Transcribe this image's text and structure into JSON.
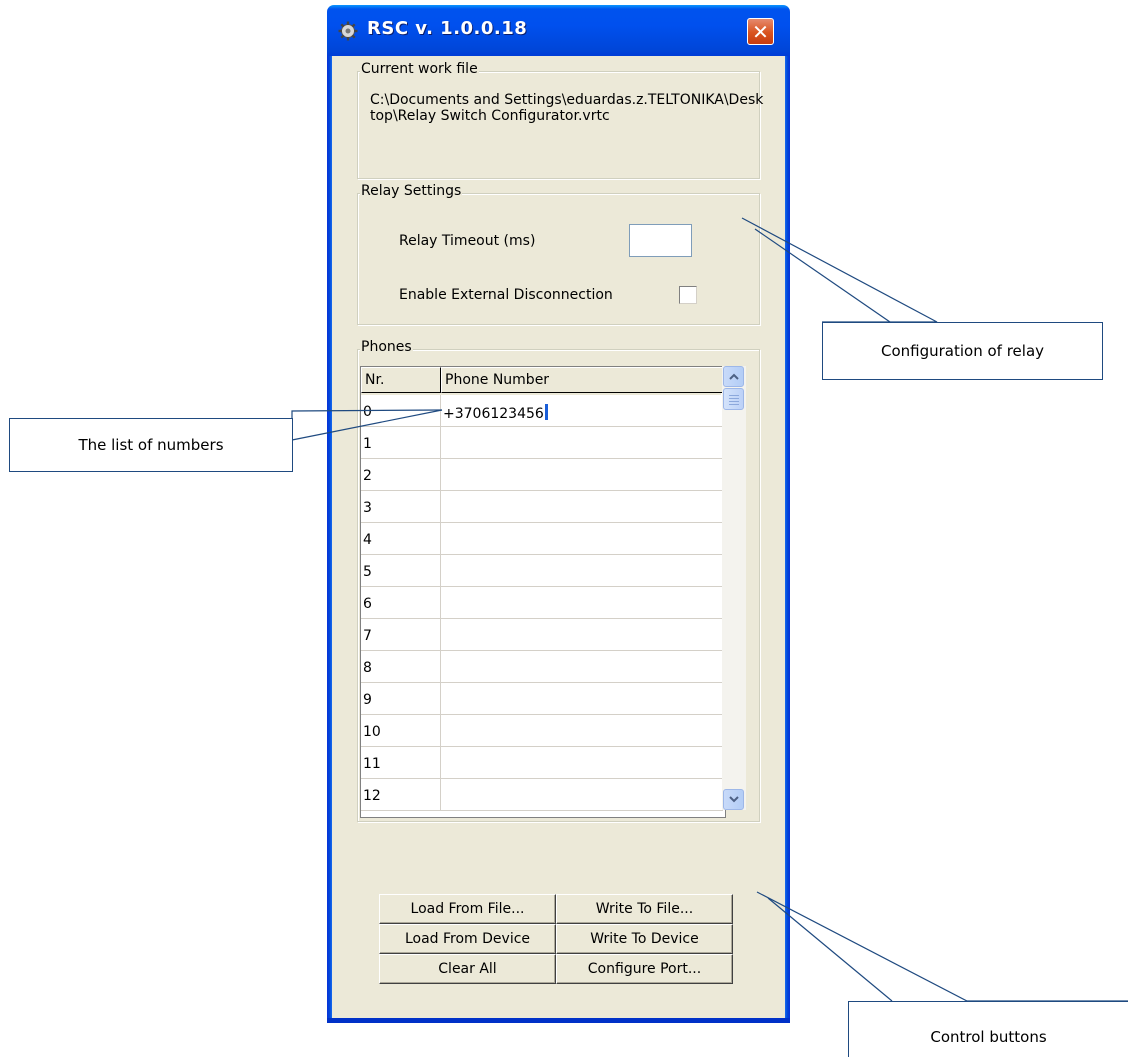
{
  "window": {
    "title": "RSC  v. 1.0.0.18",
    "close_glyph": "✕",
    "app_icon": "gear-icon"
  },
  "work_file": {
    "group_label": "Current work file",
    "path": "C:\\Documents and Settings\\eduardas.z.TELTONIKA\\Desktop\\Relay Switch Configurator.vrtc"
  },
  "relay": {
    "group_label": "Relay Settings",
    "timeout_label": "Relay Timeout (ms)",
    "timeout_value": "",
    "external_label": "Enable External Disconnection",
    "external_checked": false
  },
  "phones": {
    "group_label": "Phones",
    "columns": [
      "Nr.",
      "Phone Number"
    ],
    "rows": [
      {
        "nr": "0",
        "number": "+3706123456"
      },
      {
        "nr": "1",
        "number": ""
      },
      {
        "nr": "2",
        "number": ""
      },
      {
        "nr": "3",
        "number": ""
      },
      {
        "nr": "4",
        "number": ""
      },
      {
        "nr": "5",
        "number": ""
      },
      {
        "nr": "6",
        "number": ""
      },
      {
        "nr": "7",
        "number": ""
      },
      {
        "nr": "8",
        "number": ""
      },
      {
        "nr": "9",
        "number": ""
      },
      {
        "nr": "10",
        "number": ""
      },
      {
        "nr": "11",
        "number": ""
      },
      {
        "nr": "12",
        "number": ""
      }
    ]
  },
  "buttons": {
    "load_file": "Load From File...",
    "write_file": "Write To File...",
    "load_device": "Load From Device",
    "write_device": "Write To Device",
    "clear_all": "Clear All",
    "configure_port": "Configure Port..."
  },
  "callouts": {
    "relay": "Configuration of relay",
    "numbers": "The list of numbers",
    "buttons": "Control buttons"
  },
  "colors": {
    "title_bar": "#0050ee",
    "dialog_bg": "#ece9d8",
    "close_button": "#d9531f",
    "callout_line": "#1f4a80"
  }
}
